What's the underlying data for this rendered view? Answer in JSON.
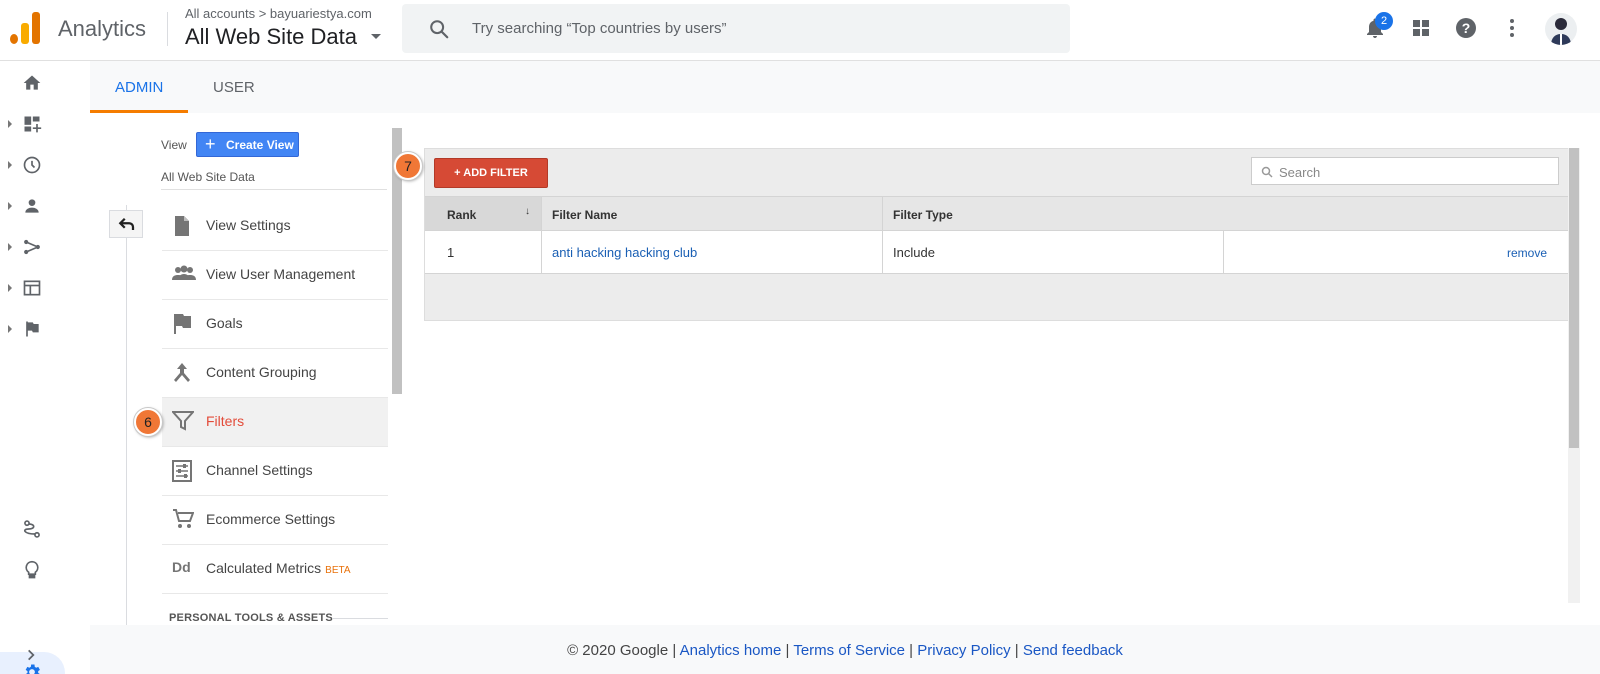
{
  "header": {
    "app_name": "Analytics",
    "breadcrumb": "All accounts > bayuariestya.com",
    "view_title": "All Web Site Data",
    "search_placeholder": "Try searching “Top countries by users”",
    "notification_count": "2",
    "icons": [
      "bell-icon",
      "apps-grid-icon",
      "help-icon",
      "more-vert-icon",
      "avatar"
    ]
  },
  "rail": {
    "items": [
      "home-icon",
      "dashboard-icon",
      "clock-icon",
      "person-icon",
      "flow-icon",
      "layout-icon",
      "flag-icon"
    ],
    "bottom_items": [
      "attribution-icon",
      "lightbulb-icon",
      "gear-icon"
    ],
    "expand_icon": "chevron-right-icon"
  },
  "tabs": {
    "admin": "ADMIN",
    "user": "USER",
    "active": "ADMIN"
  },
  "view_column": {
    "label": "View",
    "create_button": "Create View",
    "selected_view": "All Web Site Data",
    "menu": [
      {
        "label": "View Settings",
        "icon": "page-icon"
      },
      {
        "label": "View User Management",
        "icon": "people-icon"
      },
      {
        "label": "Goals",
        "icon": "flag-icon"
      },
      {
        "label": "Content Grouping",
        "icon": "merge-icon"
      },
      {
        "label": "Filters",
        "icon": "filter-icon",
        "active": true
      },
      {
        "label": "Channel Settings",
        "icon": "sliders-icon"
      },
      {
        "label": "Ecommerce Settings",
        "icon": "cart-icon"
      },
      {
        "label": "Calculated Metrics",
        "icon": "dd-icon",
        "badge": "BETA"
      }
    ],
    "section_heading": "PERSONAL TOOLS & ASSETS"
  },
  "steps": {
    "filters_step": "6",
    "add_filter_step": "7"
  },
  "filters_table": {
    "add_button": "+ ADD FILTER",
    "search_placeholder": "Search",
    "columns": [
      "Rank",
      "Filter Name",
      "Filter Type"
    ],
    "rows": [
      {
        "rank": "1",
        "name": "anti hacking hacking club",
        "type": "Include",
        "action": "remove"
      }
    ]
  },
  "footer": {
    "copyright": "© 2020 Google",
    "links": [
      "Analytics home",
      "Terms of Service",
      "Privacy Policy",
      "Send feedback"
    ]
  },
  "colors": {
    "accent_blue": "#1a73e8",
    "add_filter_red": "#d64a35",
    "active_filter_text": "#e34c3a",
    "tab_underline": "#f57c00",
    "step_marker": "#f07736"
  }
}
